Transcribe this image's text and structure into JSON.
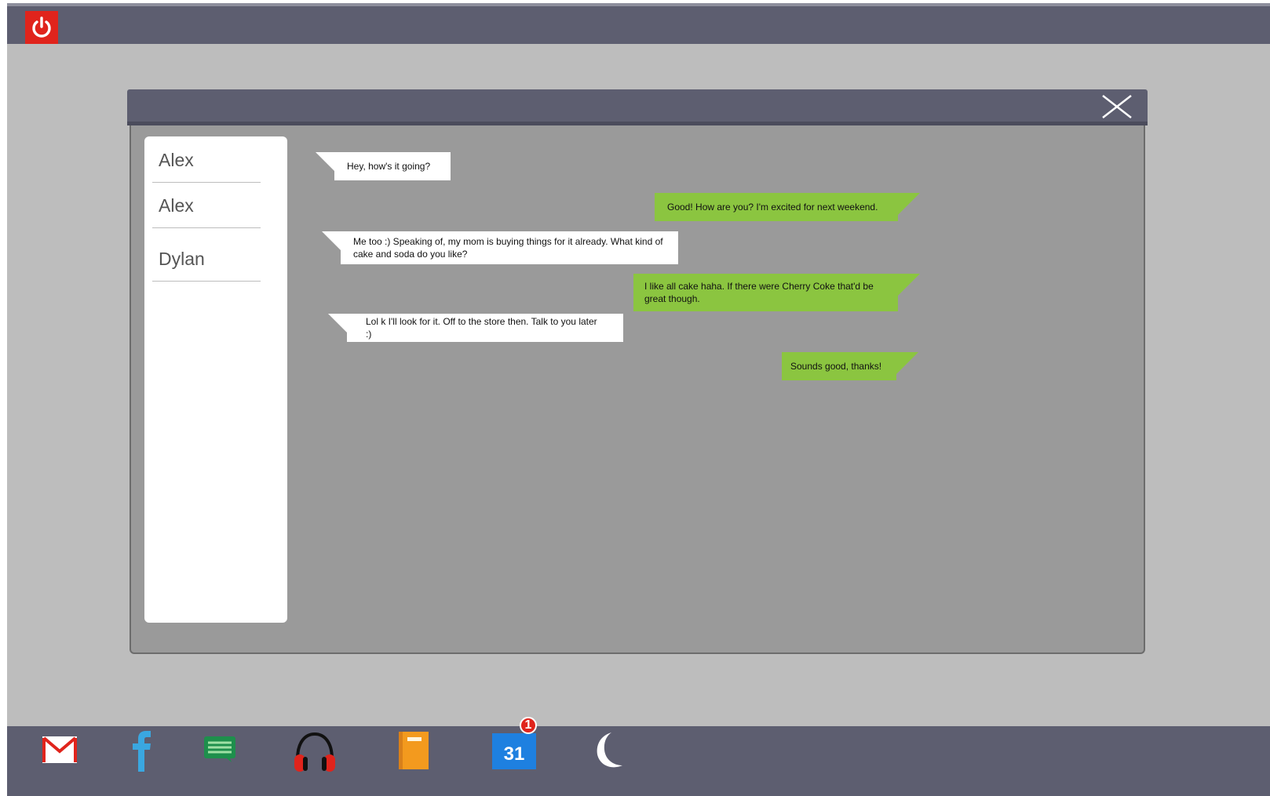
{
  "contacts": [
    {
      "name": "Alex"
    },
    {
      "name": "Alex"
    },
    {
      "name": "Dylan"
    }
  ],
  "messages": [
    {
      "direction": "in",
      "text": "Hey, how's it going?"
    },
    {
      "direction": "out",
      "text": "Good! How are you? I'm excited for next weekend."
    },
    {
      "direction": "in",
      "text": "Me too :) Speaking of, my mom is buying things for it already. What kind of cake and soda do you like?"
    },
    {
      "direction": "out",
      "text": "I like all cake haha. If there were Cherry Coke that'd be great though."
    },
    {
      "direction": "in",
      "text": "Lol k I'll look for it. Off to the store then. Talk to you later :)"
    },
    {
      "direction": "out",
      "text": "Sounds good, thanks!"
    }
  ],
  "taskbar": {
    "icons": [
      "mail-icon",
      "facebook-icon",
      "messages-icon",
      "headphones-icon",
      "notebook-icon",
      "calendar-icon",
      "moon-icon"
    ],
    "calendar_day": "31",
    "calendar_badge": "1"
  },
  "colors": {
    "bar": "#5d5e70",
    "desktop": "#bdbdbd",
    "chat_area": "#9a9a9a",
    "outgoing_bubble": "#8bc540",
    "incoming_bubble": "#ffffff",
    "power": "#e0241c"
  }
}
